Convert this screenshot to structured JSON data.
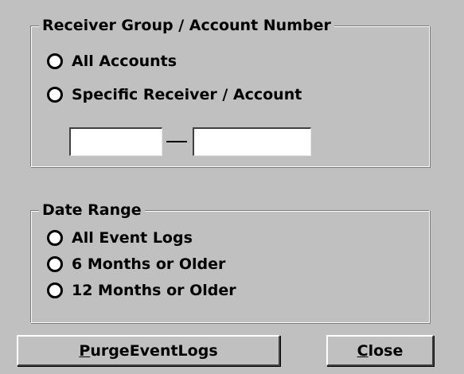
{
  "receiver_group": {
    "legend": "Receiver Group / Account Number",
    "options": [
      {
        "label": "All Accounts",
        "selected": false
      },
      {
        "label": "Specific Receiver / Account",
        "selected": false
      }
    ],
    "receiver_value": "",
    "account_value": "",
    "separator": "—"
  },
  "date_range": {
    "legend": "Date Range",
    "options": [
      {
        "label": "All Event Logs",
        "selected": false
      },
      {
        "label": "6 Months or Older",
        "selected": false
      },
      {
        "label": "12 Months or Older",
        "selected": false
      }
    ]
  },
  "buttons": {
    "purge": {
      "accel": "P",
      "rest": "urgeEventLogs"
    },
    "close": {
      "accel": "C",
      "rest": "lose"
    }
  }
}
